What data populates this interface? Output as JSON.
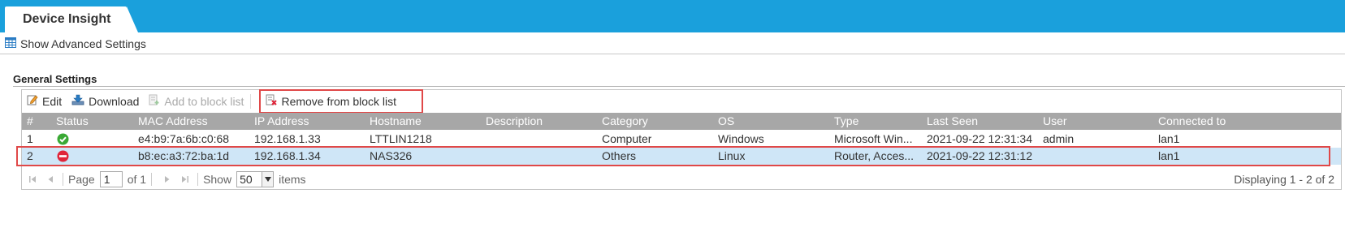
{
  "header": {
    "tab_label": "Device Insight"
  },
  "advanced": {
    "label": "Show Advanced Settings"
  },
  "section": {
    "title": "General Settings"
  },
  "toolbar": {
    "edit": "Edit",
    "download": "Download",
    "add_block": "Add to block list",
    "remove_block": "Remove from block list"
  },
  "columns": [
    "#",
    "Status",
    "MAC Address",
    "IP Address",
    "Hostname",
    "Description",
    "Category",
    "OS",
    "Type",
    "Last Seen",
    "User",
    "Connected to"
  ],
  "rows": [
    {
      "num": "1",
      "status": "ok",
      "mac": "e4:b9:7a:6b:c0:68",
      "ip": "192.168.1.33",
      "hostname": "LTTLIN1218",
      "description": "",
      "category": "Computer",
      "os": "Windows",
      "type": "Microsoft Win...",
      "last_seen": "2021-09-22 12:31:34",
      "user": "admin",
      "connected": "lan1"
    },
    {
      "num": "2",
      "status": "blocked",
      "mac": "b8:ec:a3:72:ba:1d",
      "ip": "192.168.1.34",
      "hostname": "NAS326",
      "description": "",
      "category": "Others",
      "os": "Linux",
      "type": "Router, Acces...",
      "last_seen": "2021-09-22 12:31:12",
      "user": "",
      "connected": "lan1"
    }
  ],
  "pager": {
    "page_label": "Page",
    "page_value": "1",
    "of_label": "of 1",
    "show_label": "Show",
    "page_size": "50",
    "items_label": "items",
    "displaying": "Displaying 1 - 2 of 2"
  },
  "colors": {
    "header_bg": "#1aa0dc",
    "grid_header": "#a7a7a7",
    "selected_row": "#cfe6f7",
    "highlight": "#e04848",
    "ok": "#3aa935",
    "blocked": "#e0253a"
  }
}
